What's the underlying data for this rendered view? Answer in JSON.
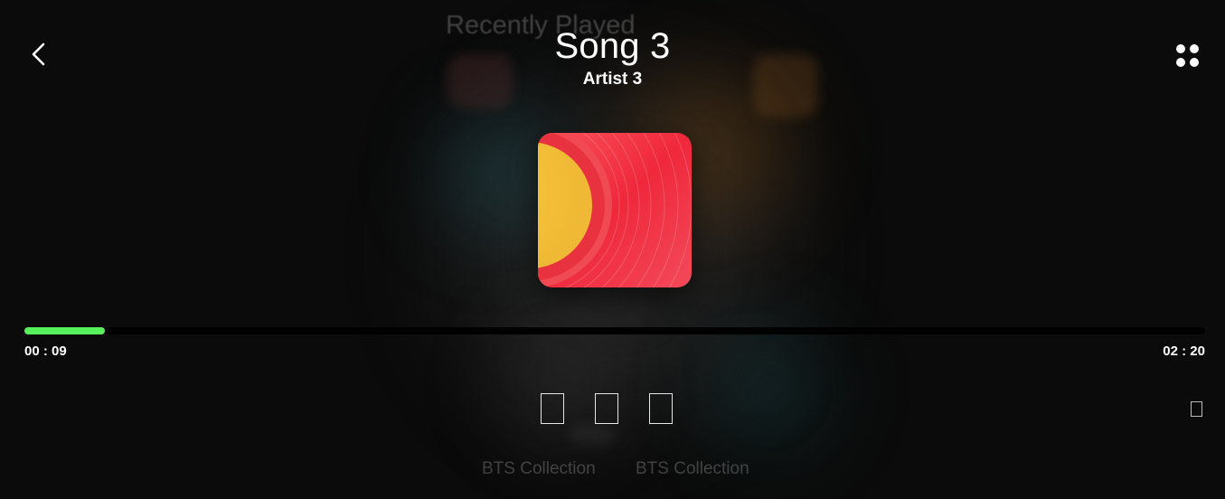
{
  "background": {
    "heading": "Recently Played",
    "collections": [
      "BTS Collection",
      "BTS Collection"
    ]
  },
  "header": {
    "back_icon": "chevron-left-icon",
    "more_icon": "grid-dots-icon"
  },
  "player": {
    "title": "Song 3",
    "artist": "Artist 3",
    "cover_icon": "vinyl-record-icon",
    "progress_fraction": 0.068,
    "time_current": "00 : 09",
    "time_total": "02 : 20",
    "controls": [
      "previous-icon",
      "play-icon",
      "next-icon"
    ],
    "extra_control": "repeat-icon"
  },
  "colors": {
    "progress": "#59f05d",
    "track": "#000000",
    "cover_red": "#f0273a",
    "cover_yellow": "#f5c43c"
  }
}
